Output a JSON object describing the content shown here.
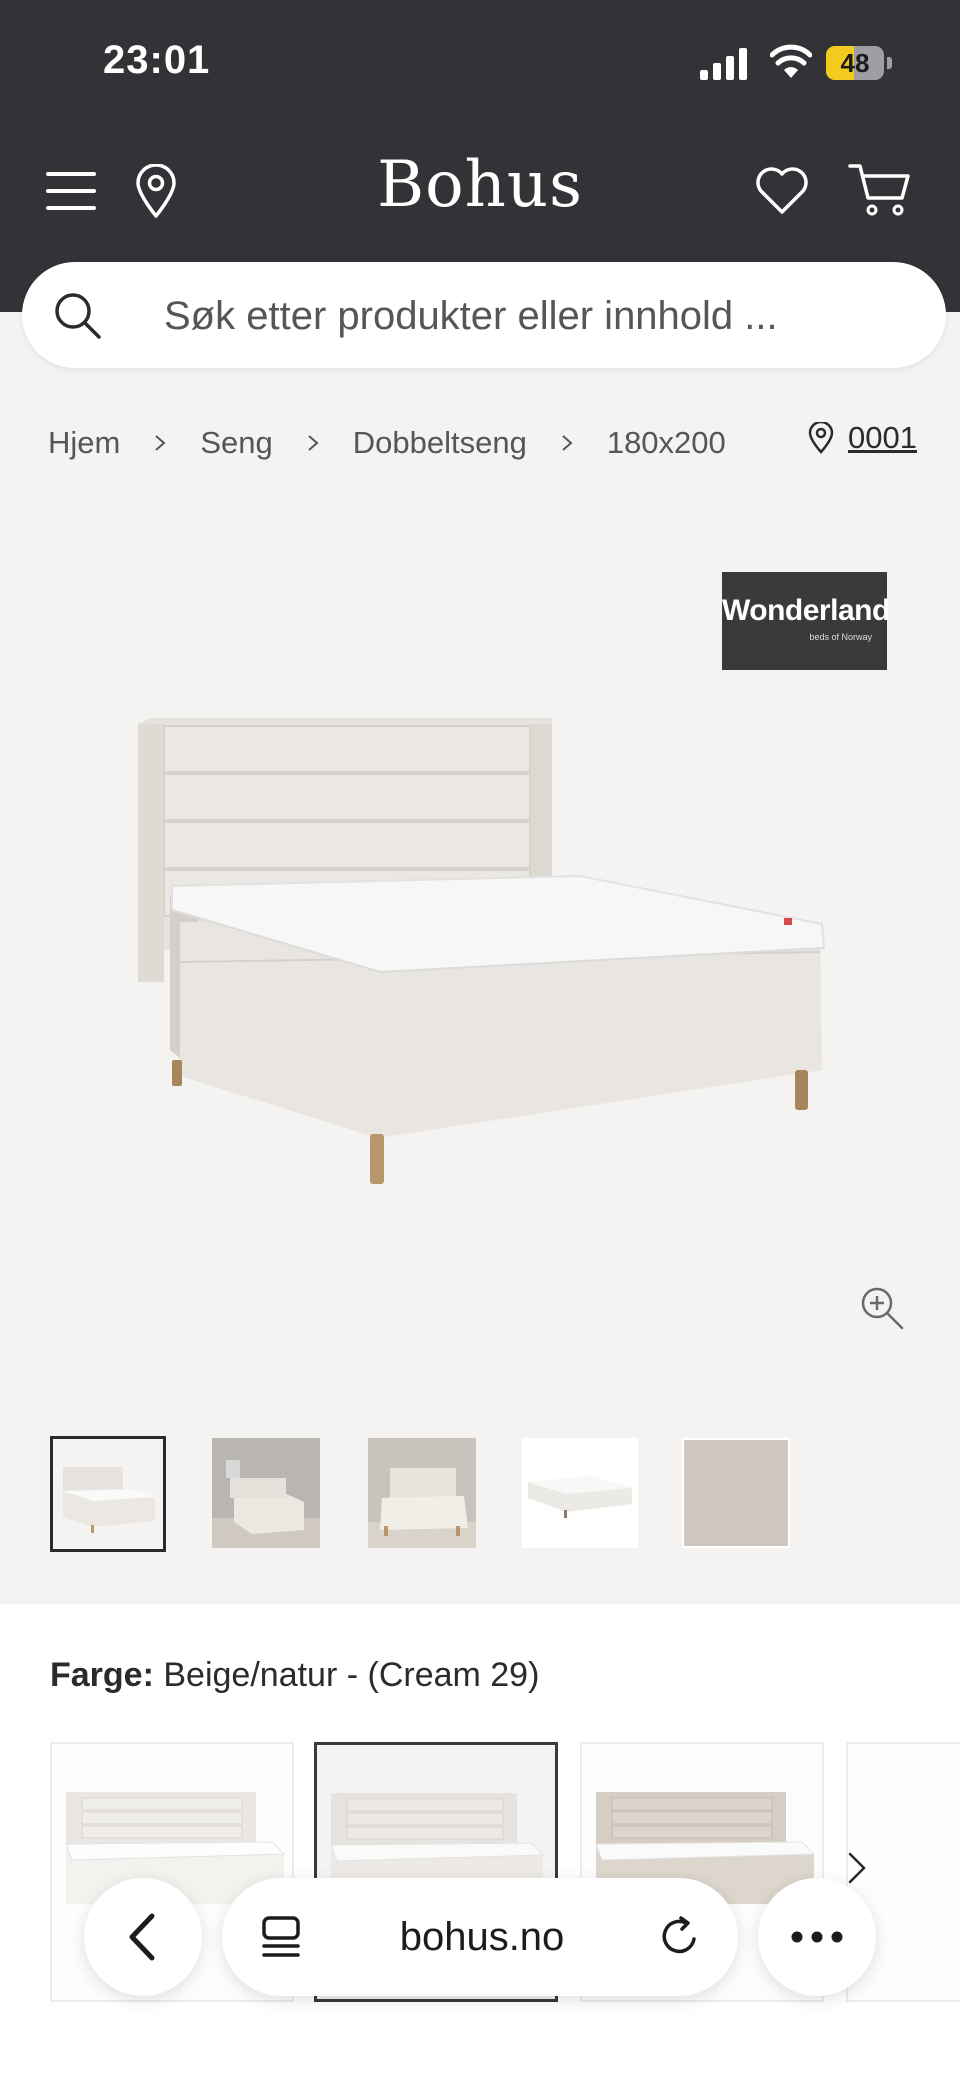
{
  "status": {
    "time": "23:01",
    "battery": "48",
    "battery_level": 0.48
  },
  "header": {
    "logo": "Bohus"
  },
  "search": {
    "placeholder": "Søk etter produkter eller innhold ..."
  },
  "breadcrumb": {
    "items": [
      "Hjem",
      "Seng",
      "Dobbeltseng",
      "180x200"
    ],
    "store": "0001"
  },
  "product": {
    "brand": "Wonderland",
    "brand_tagline": "beds of Norway",
    "thumbnails_count": 5
  },
  "color": {
    "label": "Farge:",
    "value": "Beige/natur - (Cream 29)"
  },
  "browser": {
    "url": "bohus.no"
  },
  "colors": {
    "header_bg": "#333236",
    "page_bg": "#f4f3f2",
    "battery_yellow": "#f3cb1f"
  }
}
